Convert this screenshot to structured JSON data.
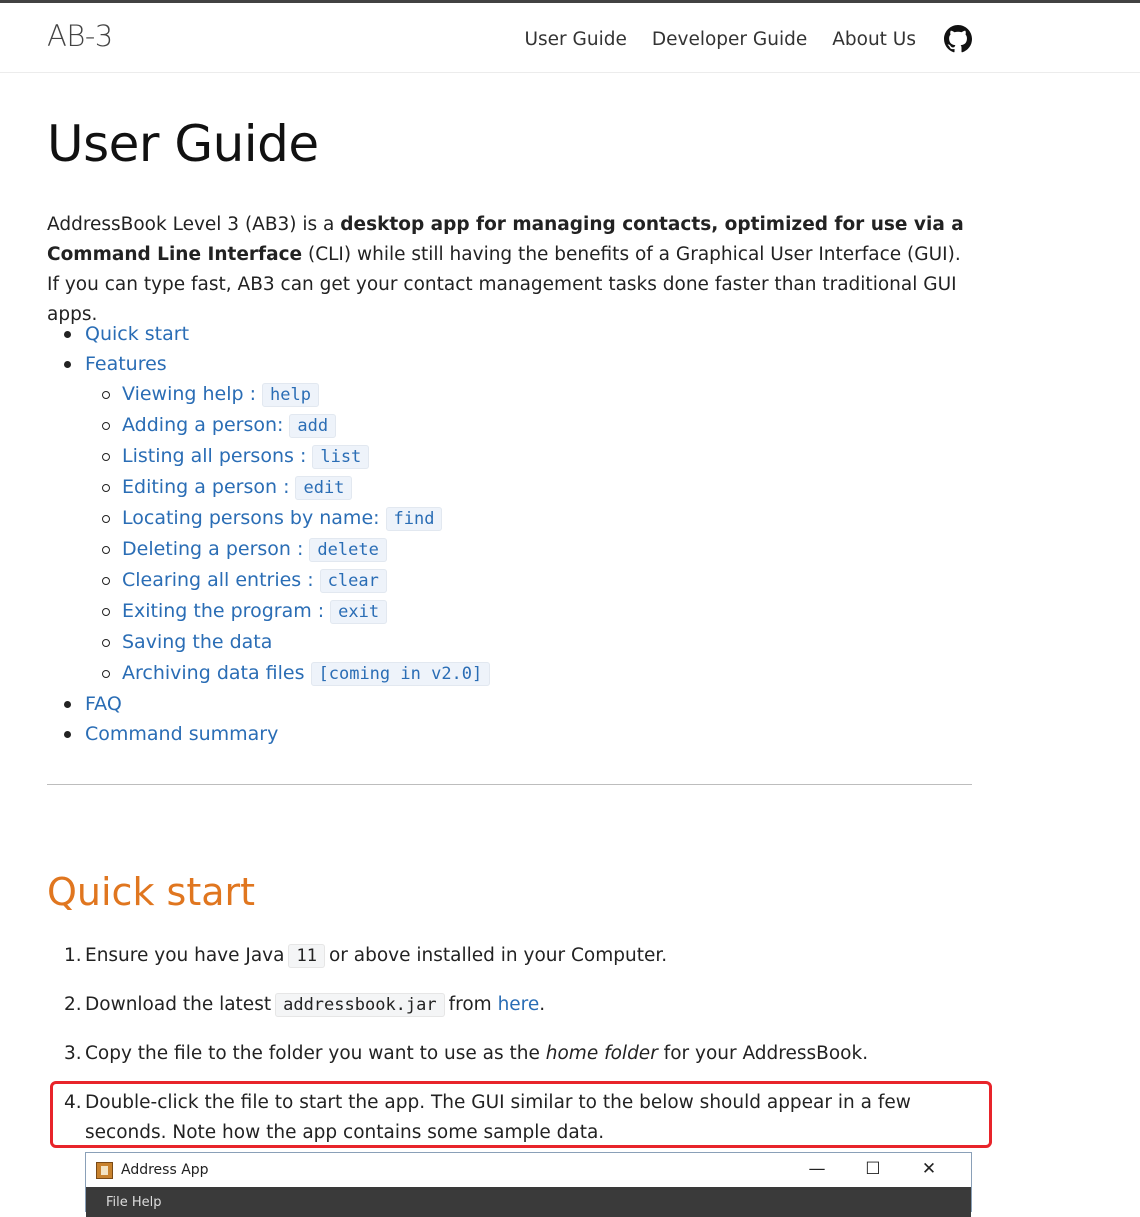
{
  "nav": {
    "brand": "AB-3",
    "links": [
      "User Guide",
      "Developer Guide",
      "About Us"
    ]
  },
  "page": {
    "title": "User Guide",
    "intro": {
      "p1": "AddressBook Level 3 (AB3) is a ",
      "b1": "desktop app for managing contacts, optimized for use via a Command Line Interface",
      "p2": " (CLI) while still having the benefits of a Graphical User Interface (GUI). If you can type fast, AB3 can get your contact management tasks done faster than traditional GUI apps."
    }
  },
  "toc": {
    "quick_start": "Quick start",
    "features": "Features",
    "feature_items": [
      {
        "label": "Viewing help :",
        "code": "help"
      },
      {
        "label": "Adding a person:",
        "code": "add"
      },
      {
        "label": "Listing all persons :",
        "code": "list"
      },
      {
        "label": "Editing a person :",
        "code": "edit"
      },
      {
        "label": "Locating persons by name:",
        "code": "find"
      },
      {
        "label": "Deleting a person :",
        "code": "delete"
      },
      {
        "label": "Clearing all entries :",
        "code": "clear"
      },
      {
        "label": "Exiting the program :",
        "code": "exit"
      },
      {
        "label": "Saving the data",
        "code": ""
      },
      {
        "label": "Archiving data files",
        "code": "[coming in v2.0]"
      }
    ],
    "faq": "FAQ",
    "command_summary": "Command summary"
  },
  "quick_start": {
    "heading": "Quick start",
    "steps": [
      {
        "num": "1.",
        "a": "Ensure you have Java",
        "code": "11",
        "b": "or above installed in your Computer."
      },
      {
        "num": "2.",
        "a": "Download the latest",
        "code": "addressbook.jar",
        "b": "from",
        "link": "here",
        "c": "."
      },
      {
        "num": "3.",
        "a": "Copy the file to the folder you want to use as the ",
        "em": "home folder",
        "b": " for your AddressBook."
      },
      {
        "num": "4.",
        "a": "Double-click the file to start the app. The GUI similar to the below should appear in a few seconds. Note how the app contains some sample data."
      }
    ]
  },
  "app_window": {
    "title": "Address App",
    "controls": [
      "—",
      "☐",
      "✕"
    ],
    "menu_hint": "File   Help"
  }
}
